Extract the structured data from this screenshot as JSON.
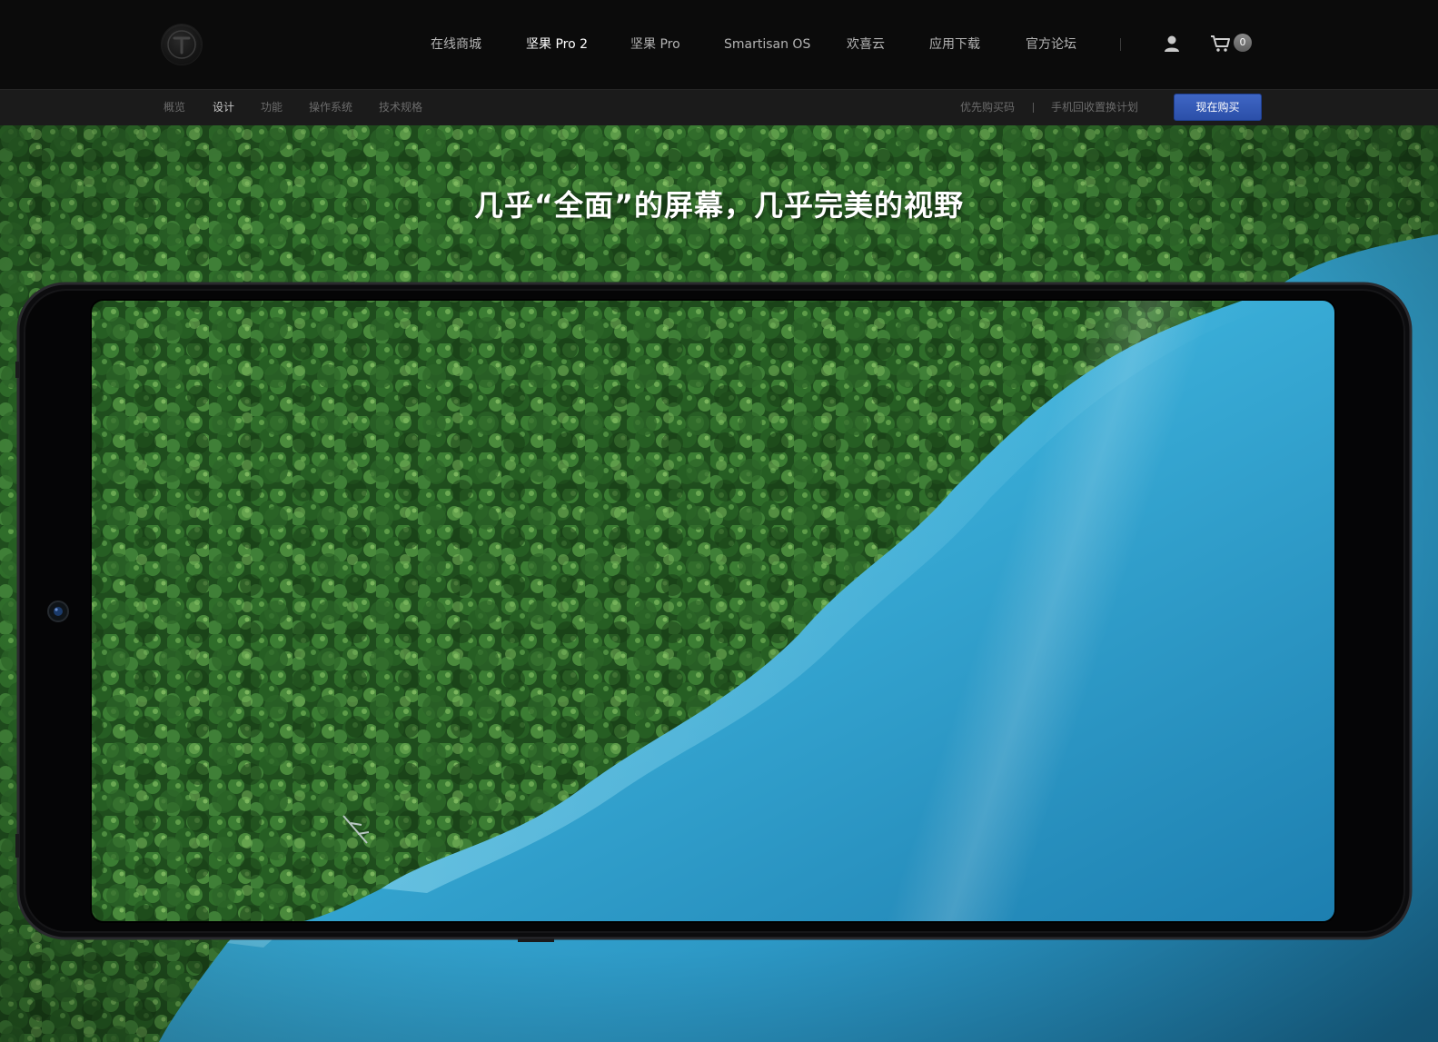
{
  "nav": {
    "items": [
      {
        "label": "在线商城"
      },
      {
        "label": "坚果 Pro 2"
      },
      {
        "label": "坚果 Pro"
      },
      {
        "label": "Smartisan OS"
      },
      {
        "label": "欢喜云"
      },
      {
        "label": "应用下载"
      },
      {
        "label": "官方论坛"
      }
    ],
    "active_item": "坚果 Pro 2",
    "user_icon": "user-icon",
    "cart_icon": "cart-icon",
    "cart_count": "0"
  },
  "subnav": {
    "items": [
      {
        "label": "概览"
      },
      {
        "label": "设计"
      },
      {
        "label": "功能"
      },
      {
        "label": "操作系统"
      },
      {
        "label": "技术规格"
      }
    ],
    "active_item": "设计",
    "right_links": [
      {
        "label": "优先购买码"
      },
      {
        "label": "手机回收置换计划"
      }
    ],
    "buy_button": "现在购买"
  },
  "hero": {
    "title": "几乎“全面”的屏幕，几乎完美的视野"
  },
  "colors": {
    "nav_bg": "#0b0b0b",
    "subnav_bg": "#1b1b1b",
    "buy_button": "#2f54b0",
    "forest": "#2f6a2a",
    "water": "#2fa3cf"
  }
}
